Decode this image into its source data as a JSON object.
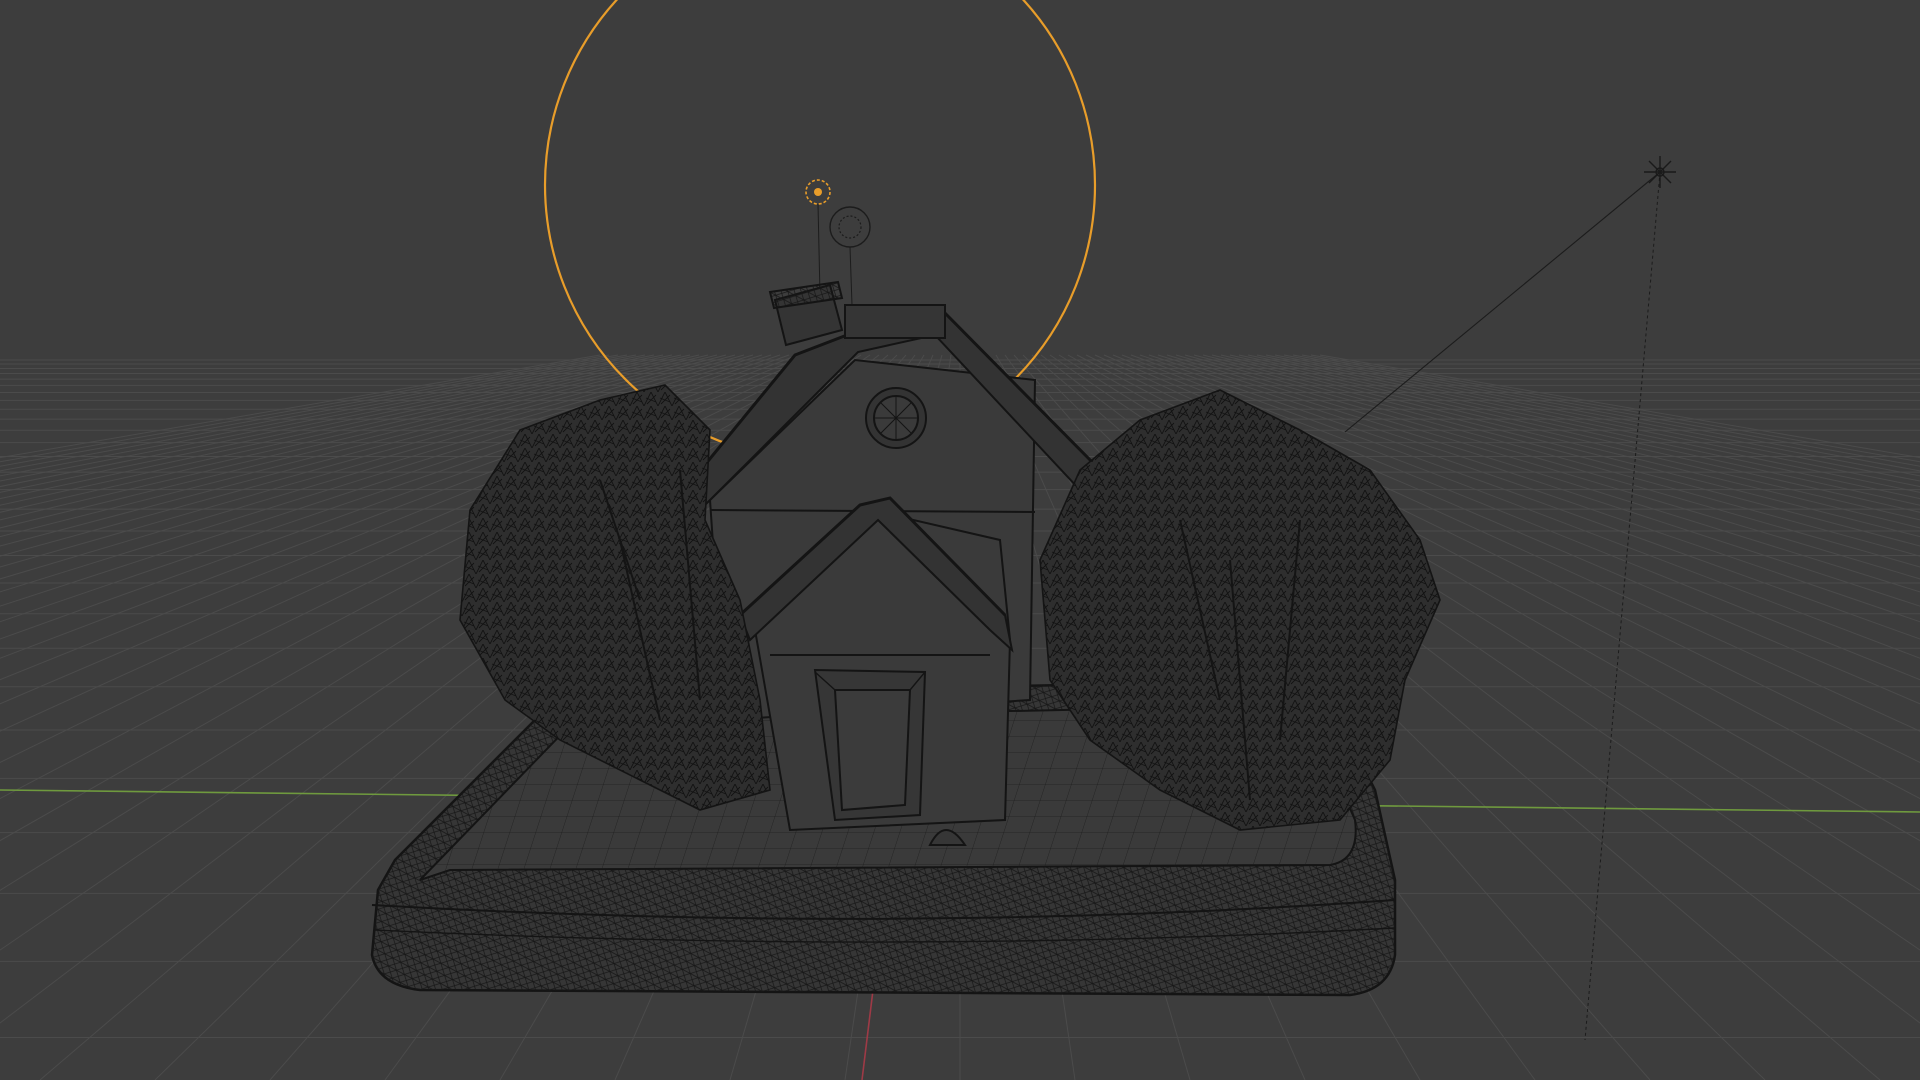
{
  "viewport": {
    "mode": "wireframe",
    "colors": {
      "background": "#3d3d3d",
      "grid_line": "#4a4a4a",
      "x_axis": "#6f9a3e",
      "y_axis": "#9e3a46",
      "wire": "#141414",
      "selected": "#e89d2a",
      "light_gizmo": "#1a1a1a"
    }
  },
  "objects": [
    {
      "name": "house",
      "icon": "house-wireframe"
    },
    {
      "name": "tree-left",
      "icon": "tree-wireframe"
    },
    {
      "name": "tree-right",
      "icon": "tree-wireframe"
    },
    {
      "name": "ground-base",
      "icon": "base-wireframe"
    },
    {
      "name": "sun-light",
      "icon": "sun-light-icon",
      "selected": true
    },
    {
      "name": "point-light",
      "icon": "point-light-icon"
    },
    {
      "name": "star-light",
      "icon": "star-light-icon"
    }
  ]
}
